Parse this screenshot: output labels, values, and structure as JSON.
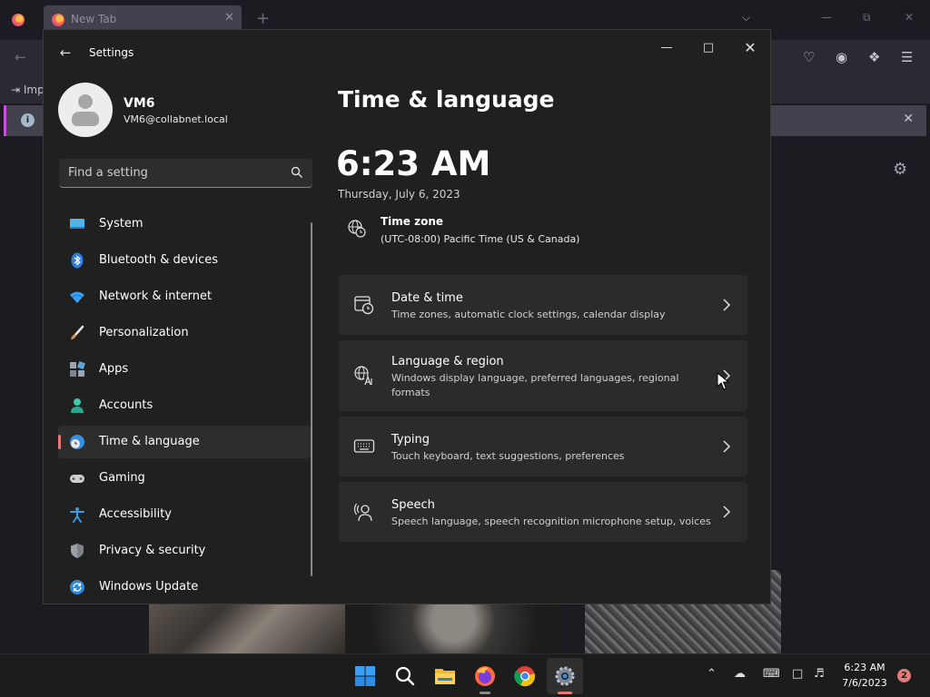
{
  "browser": {
    "tab_title": "New Tab",
    "tab_close": "✕",
    "new_tab": "+",
    "bookmark_import": "Imp",
    "notice_info": "i",
    "notice_close": "✕"
  },
  "settings": {
    "app_title": "Settings",
    "profile": {
      "name": "VM6",
      "email": "VM6@collabnet.local"
    },
    "search": {
      "placeholder": "Find a setting"
    },
    "nav": [
      {
        "label": "System",
        "icon": "monitor-icon"
      },
      {
        "label": "Bluetooth & devices",
        "icon": "bluetooth-icon"
      },
      {
        "label": "Network & internet",
        "icon": "wifi-icon"
      },
      {
        "label": "Personalization",
        "icon": "brush-icon"
      },
      {
        "label": "Apps",
        "icon": "apps-icon"
      },
      {
        "label": "Accounts",
        "icon": "person-icon"
      },
      {
        "label": "Time & language",
        "icon": "globe-clock-icon",
        "active": true
      },
      {
        "label": "Gaming",
        "icon": "gamepad-icon"
      },
      {
        "label": "Accessibility",
        "icon": "accessibility-icon"
      },
      {
        "label": "Privacy & security",
        "icon": "shield-icon"
      },
      {
        "label": "Windows Update",
        "icon": "update-icon"
      }
    ],
    "page_title": "Time & language",
    "clock": "6:23 AM",
    "date": "Thursday, July 6, 2023",
    "time_zone": {
      "title": "Time zone",
      "value": "(UTC-08:00) Pacific Time (US & Canada)"
    },
    "cards": [
      {
        "title": "Date & time",
        "desc": "Time zones, automatic clock settings, calendar display",
        "icon": "calendar-clock-icon"
      },
      {
        "title": "Language & region",
        "desc": "Windows display language, preferred languages, regional formats",
        "icon": "language-icon"
      },
      {
        "title": "Typing",
        "desc": "Touch keyboard, text suggestions, preferences",
        "icon": "keyboard-icon"
      },
      {
        "title": "Speech",
        "desc": "Speech language, speech recognition microphone setup, voices",
        "icon": "speech-icon"
      }
    ]
  },
  "taskbar": {
    "apps": [
      "start-icon",
      "search-icon",
      "file-explorer-icon",
      "firefox-icon",
      "chrome-icon",
      "settings-icon"
    ],
    "time": "6:23 AM",
    "date": "7/6/2023",
    "notification_count": "2"
  },
  "colors": {
    "accent": "#e47b79",
    "window_bg": "#202020",
    "card_bg": "#2b2b2b"
  }
}
